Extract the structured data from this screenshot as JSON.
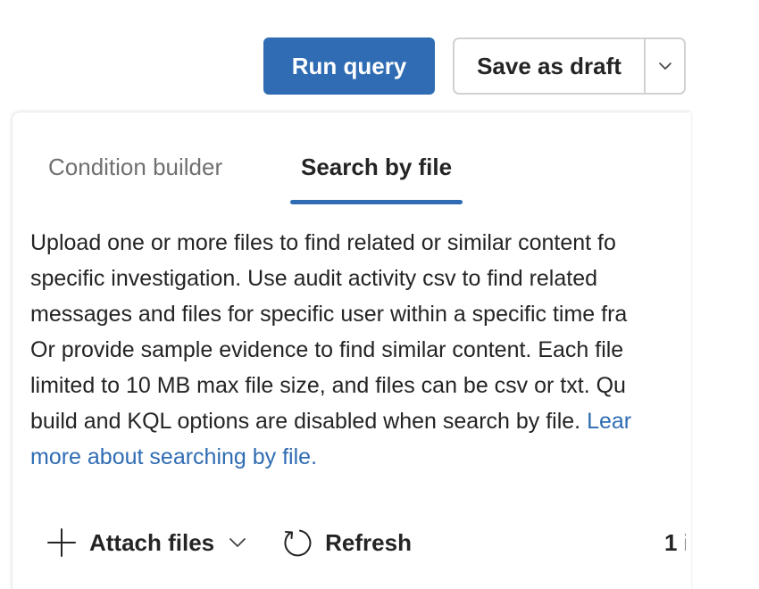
{
  "toolbar": {
    "run_label": "Run query",
    "save_draft_label": "Save as draft"
  },
  "tabs": [
    {
      "label": "Condition builder",
      "selected": false
    },
    {
      "label": "Search by file",
      "selected": true
    }
  ],
  "description": {
    "lines": [
      "Upload one or more files to find related or similar content fo",
      "specific investigation. Use audit activity csv to find related",
      "messages and files for specific user within a specific time fra",
      "Or provide sample evidence to find similar content. Each file",
      "limited to 10 MB max file size, and files can be csv or txt. Qu",
      "build and KQL options are disabled when search by file. "
    ],
    "link_part1": "Lear",
    "link_part2": "more about searching by file."
  },
  "actions": {
    "attach_label": "Attach files",
    "refresh_label": "Refresh",
    "count_text": "1 i"
  },
  "colors": {
    "accent": "#2f6cb3",
    "text": "#242424",
    "muted": "#707070",
    "border": "#d1d1d1"
  },
  "icons": {
    "attach": "plus-icon",
    "attach_menu": "chevron-down-icon",
    "refresh": "refresh-icon",
    "split_menu": "chevron-down-icon"
  }
}
